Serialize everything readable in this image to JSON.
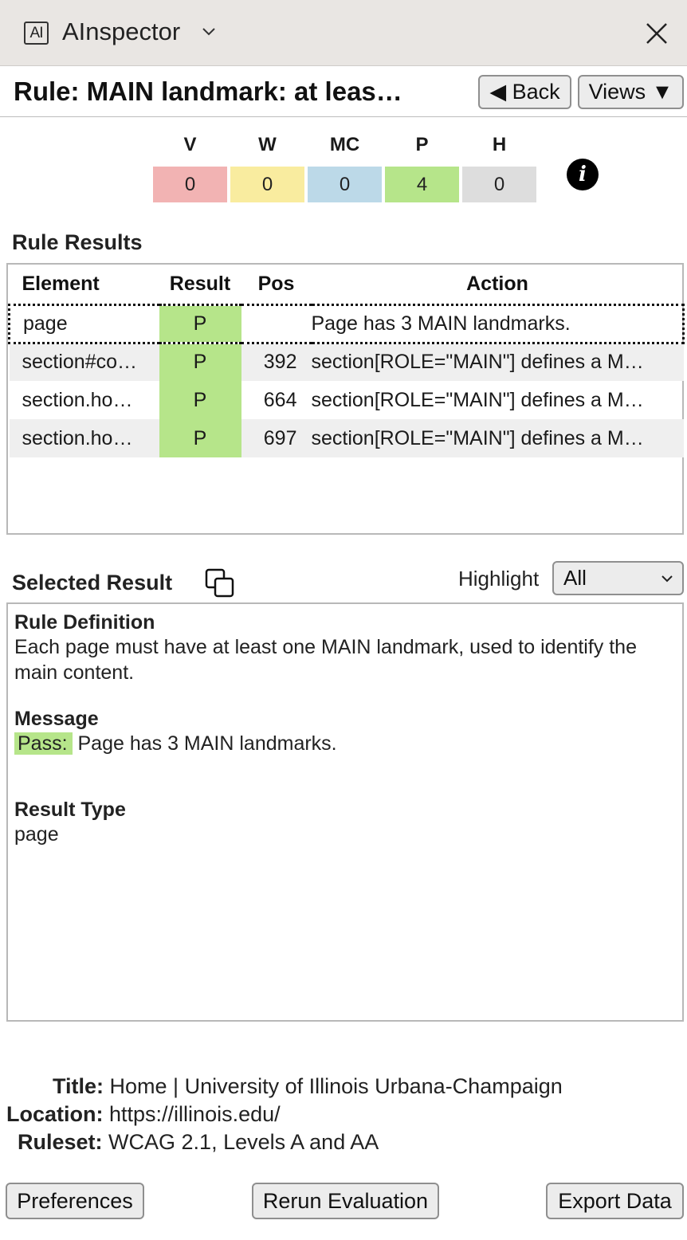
{
  "app": {
    "logo": "AI",
    "title": "AInspector"
  },
  "rule": {
    "title": "Rule: MAIN landmark: at leas…"
  },
  "buttons": {
    "back": "◀ Back",
    "views": "Views ▼"
  },
  "summary": [
    {
      "label": "V",
      "value": "0",
      "color": "#f2b3b3"
    },
    {
      "label": "W",
      "value": "0",
      "color": "#f9ec9f"
    },
    {
      "label": "MC",
      "value": "0",
      "color": "#bcd9e8"
    },
    {
      "label": "P",
      "value": "4",
      "color": "#b6e58a"
    },
    {
      "label": "H",
      "value": "0",
      "color": "#dddddd"
    }
  ],
  "results": {
    "heading": "Rule Results",
    "columns": {
      "element": "Element",
      "result": "Result",
      "pos": "Pos",
      "action": "Action"
    },
    "rows": [
      {
        "element": "page",
        "result": "P",
        "pos": "",
        "action": "Page has 3 MAIN landmarks."
      },
      {
        "element": "section#co…",
        "result": "P",
        "pos": "392",
        "action": "section[ROLE=\"MAIN\"] defines a M…"
      },
      {
        "element": "section.ho…",
        "result": "P",
        "pos": "664",
        "action": "section[ROLE=\"MAIN\"] defines a M…"
      },
      {
        "element": "section.ho…",
        "result": "P",
        "pos": "697",
        "action": "section[ROLE=\"MAIN\"] defines a M…"
      }
    ]
  },
  "selected": {
    "heading": "Selected Result",
    "highlight_label": "Highlight",
    "highlight_value": "All",
    "definition_heading": "Rule Definition",
    "definition": "Each page must have at least one MAIN landmark, used to identify the main content.",
    "message_heading": "Message",
    "message_tag": "Pass:",
    "message": "Page has 3 MAIN landmarks.",
    "type_heading": "Result Type",
    "type": "page"
  },
  "info": {
    "title_label": "Title:",
    "title_value": "Home | University of Illinois Urbana-Champaign",
    "location_label": "Location:",
    "location_value": "https://illinois.edu/",
    "ruleset_label": "Ruleset:",
    "ruleset_value": "WCAG 2.1, Levels A and AA"
  },
  "footer": {
    "preferences": "Preferences",
    "rerun": "Rerun Evaluation",
    "export": "Export Data"
  },
  "icons": {
    "dropdown": "chevron-down-icon",
    "close": "close-icon",
    "info": "info-icon",
    "copy": "copy-icon"
  }
}
